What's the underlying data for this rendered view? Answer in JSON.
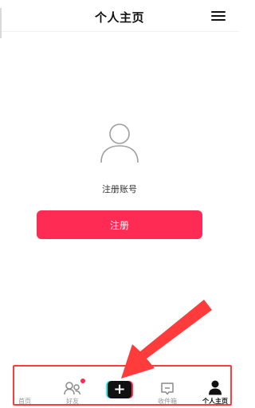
{
  "header": {
    "title": "个人主页",
    "menu_icon": "menu-icon"
  },
  "main": {
    "avatar_icon": "user-avatar-icon",
    "signup_label": "注册账号",
    "signup_button_label": "注册"
  },
  "bottom_nav": {
    "items": [
      {
        "label": "首页",
        "icon": "",
        "active": false
      },
      {
        "label": "好友",
        "icon": "friends-icon",
        "active": false,
        "has_notification": true
      },
      {
        "label": "",
        "icon": "create-plus-icon",
        "active": false
      },
      {
        "label": "收件箱",
        "icon": "inbox-icon",
        "active": false
      },
      {
        "label": "个人主页",
        "icon": "profile-icon",
        "active": true
      }
    ]
  },
  "annotations": {
    "arrow_color": "#ff3b3b",
    "box_color": "#ff3b3b"
  },
  "colors": {
    "accent": "#fe2c55",
    "create_cyan": "#25f4ee",
    "text_primary": "#111111",
    "text_muted": "#9a9a9a"
  }
}
